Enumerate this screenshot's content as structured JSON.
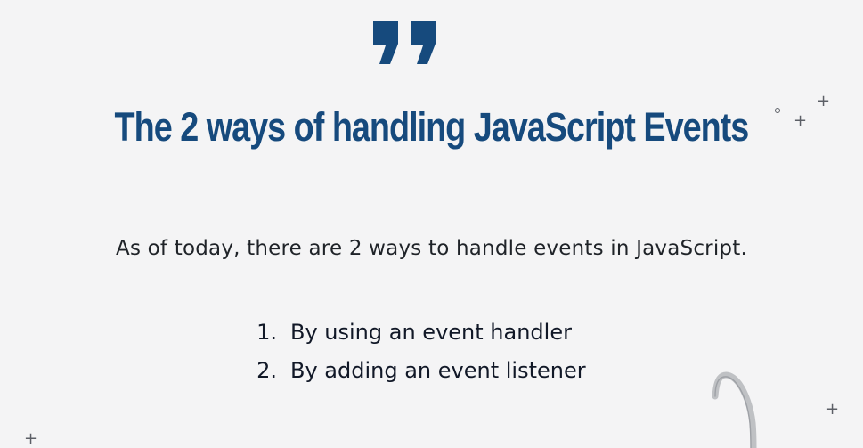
{
  "slide": {
    "title": "The 2 ways of handling JavaScript Events",
    "intro": "As of today, there are 2 ways to handle events in JavaScript.",
    "ways": [
      {
        "number": "1.",
        "text": "By using an event handler"
      },
      {
        "number": "2.",
        "text": "By adding an event listener"
      }
    ]
  },
  "decorations": {
    "quote_icon": "quote-icon",
    "plus_icon": "plus-icon",
    "circle_icon": "circle-icon",
    "arrow_icon": "curved-arrow-icon",
    "plus_symbol": "+"
  },
  "colors": {
    "background": "#f4f4f5",
    "accent": "#164a7d",
    "text": "#1f2328",
    "decorative": "#5c5f66",
    "arrow": "#bfc1c4"
  }
}
